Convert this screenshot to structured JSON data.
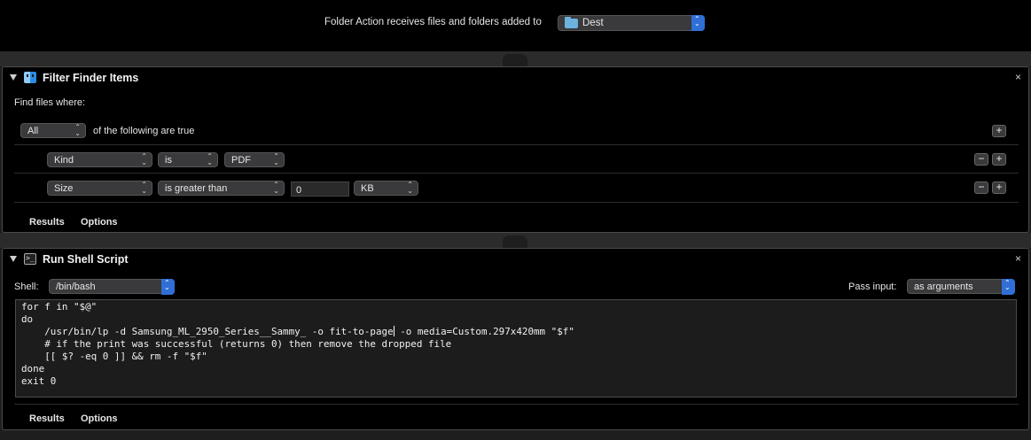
{
  "top": {
    "label": "Folder Action receives files and folders added to",
    "folder": "Dest"
  },
  "filter": {
    "title": "Filter Finder Items",
    "find_label": "Find files where:",
    "match": "All",
    "match_suffix": "of the following are true",
    "rules": [
      {
        "attribute": "Kind",
        "operator": "is",
        "value": "PDF"
      },
      {
        "attribute": "Size",
        "operator": "is greater than",
        "value": "0",
        "unit": "KB"
      }
    ],
    "tabs": [
      "Results",
      "Options"
    ]
  },
  "shell": {
    "title": "Run Shell Script",
    "shell_label": "Shell:",
    "shell": "/bin/bash",
    "pass_label": "Pass input:",
    "pass_value": "as arguments",
    "script_lines": [
      "for f in \"$@\"",
      "do",
      "    /usr/bin/lp -d Samsung_ML_2950_Series__Sammy_ -o fit-to-page",
      "    # if the print was successful (returns 0) then remove the dropped file",
      "    [[ $? -eq 0 ]] && rm -f \"$f\"",
      "done",
      "exit 0"
    ],
    "script_line3_after_cursor": " -o media=Custom.297x420mm \"$f\"",
    "tabs": [
      "Results",
      "Options"
    ]
  },
  "symbols": {
    "plus": "+",
    "minus": "−",
    "close": "×"
  },
  "icons": {
    "folder": "folder-icon",
    "finder": "finder-icon",
    "terminal": "terminal-icon"
  },
  "colors": {
    "accent": "#2f6fd6",
    "folder": "#6cb2df"
  }
}
